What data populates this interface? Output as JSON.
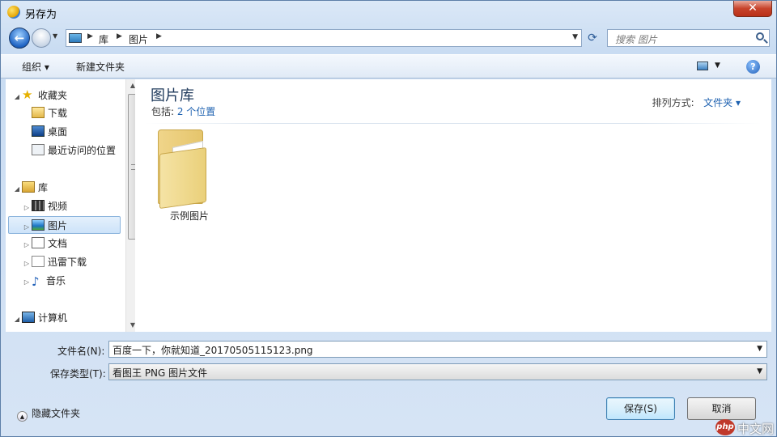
{
  "window": {
    "title": "另存为",
    "close_glyph": "✕"
  },
  "nav": {
    "back_glyph": "←",
    "forward_glyph": "",
    "history_glyph": "▼"
  },
  "address": {
    "crumbs": [
      "库",
      "图片"
    ],
    "sep": "▶",
    "drop": "▼"
  },
  "refresh_glyph": "⟳",
  "search": {
    "placeholder": "搜索 图片"
  },
  "toolbar": {
    "organize": "组织 ▾",
    "new_folder": "新建文件夹",
    "view_drop": "▼",
    "help": "?"
  },
  "sidebar": {
    "favorites": {
      "label": "收藏夹",
      "items": [
        "下载",
        "桌面",
        "最近访问的位置"
      ]
    },
    "libraries": {
      "label": "库",
      "items": [
        "视频",
        "图片",
        "文档",
        "迅雷下载",
        "音乐"
      ]
    },
    "computer": {
      "label": "计算机"
    },
    "expand_open": "◢",
    "expand_closed": "▷",
    "scroll_up": "▲",
    "scroll_down": "▼"
  },
  "content": {
    "title": "图片库",
    "subtitle_prefix": "包括: ",
    "subtitle_link": "2 个位置",
    "arrange_label": "排列方式:",
    "arrange_value": "文件夹 ▾",
    "folders": [
      {
        "name": "示例图片"
      }
    ]
  },
  "form": {
    "filename_label": "文件名(N):",
    "filename_value": "百度一下，你就知道_20170505115123.png",
    "filetype_label": "保存类型(T):",
    "filetype_value": "看图王 PNG 图片文件",
    "combo_arrow": "▼"
  },
  "footer": {
    "hide_folders": "隐藏文件夹",
    "hide_glyph": "▲",
    "save": "保存(S)",
    "cancel": "取消"
  },
  "watermark": {
    "logo": "php",
    "text": "中文网"
  }
}
